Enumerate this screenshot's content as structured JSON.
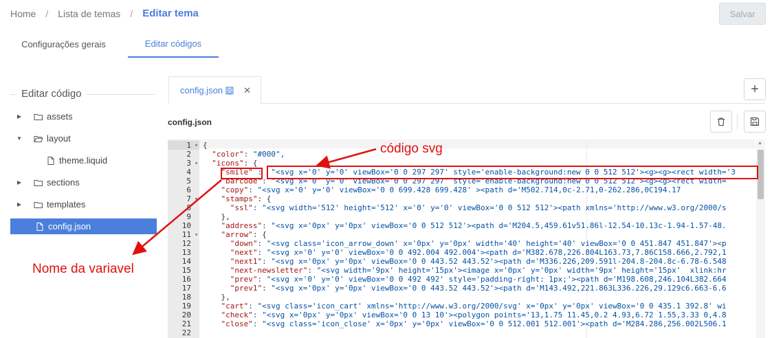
{
  "breadcrumb": {
    "home": "Home",
    "list": "Lista de temas",
    "current": "Editar tema",
    "separator": "/"
  },
  "header": {
    "save_label": "Salvar"
  },
  "tabs": [
    {
      "label": "Configurações gerais",
      "active": false
    },
    {
      "label": "Editar códigos",
      "active": true
    }
  ],
  "sidebar": {
    "title": "Editar código",
    "items": [
      {
        "label": "assets",
        "caret": "▶",
        "icon": "folder-icon"
      },
      {
        "label": "layout",
        "caret": "▼",
        "icon": "folder-open-icon"
      },
      {
        "label": "theme.liquid",
        "caret": "",
        "icon": "file-icon"
      },
      {
        "label": "sections",
        "caret": "▶",
        "icon": "folder-icon"
      },
      {
        "label": "templates",
        "caret": "▶",
        "icon": "folder-icon"
      },
      {
        "label": "config.json",
        "caret": "",
        "icon": "file-icon",
        "selected": true
      }
    ]
  },
  "editor": {
    "open_tab": "config.json",
    "tab_close": "✕",
    "add_label": "+",
    "file_title": "config.json",
    "gutter": [
      {
        "n": "1",
        "fold": "▾"
      },
      {
        "n": "2",
        "fold": ""
      },
      {
        "n": "3",
        "fold": "▾"
      },
      {
        "n": "4",
        "fold": ""
      },
      {
        "n": "5",
        "fold": ""
      },
      {
        "n": "6",
        "fold": ""
      },
      {
        "n": "7",
        "fold": "▾"
      },
      {
        "n": "8",
        "fold": ""
      },
      {
        "n": "9",
        "fold": ""
      },
      {
        "n": "10",
        "fold": ""
      },
      {
        "n": "11",
        "fold": "▾"
      },
      {
        "n": "12",
        "fold": ""
      },
      {
        "n": "13",
        "fold": ""
      },
      {
        "n": "14",
        "fold": ""
      },
      {
        "n": "15",
        "fold": ""
      },
      {
        "n": "16",
        "fold": ""
      },
      {
        "n": "17",
        "fold": ""
      },
      {
        "n": "18",
        "fold": ""
      },
      {
        "n": "19",
        "fold": ""
      },
      {
        "n": "20",
        "fold": ""
      },
      {
        "n": "21",
        "fold": ""
      },
      {
        "n": "22",
        "fold": ""
      }
    ],
    "lines": [
      {
        "indent": "",
        "key": "",
        "rest": "{"
      },
      {
        "indent": "  ",
        "key": "\"color\"",
        "rest": ": \"#000\","
      },
      {
        "indent": "  ",
        "key": "\"icons\"",
        "rest": ": {"
      },
      {
        "indent": "    ",
        "key": "\"smile\"",
        "rest": " :  \"<svg x='0' y='0' viewBox='0 0 297 297' style='enable-background:new 0 0 512 512'><g><g><rect width='3"
      },
      {
        "indent": "    ",
        "key": "\"barcode\"",
        "rest": ": \"<svg x='0' y='0' viewBox='0 0 297 297' style='enable-background:new 0 0 512 512'><g><g><rect width="
      },
      {
        "indent": "    ",
        "key": "\"copy\"",
        "rest": ": \"<svg x='0' y='0' viewBox='0 0 699.428 699.428' ><path d='M502.714,0c-2.71,0-262.286,0C194.17"
      },
      {
        "indent": "    ",
        "key": "\"stamps\"",
        "rest": ": {"
      },
      {
        "indent": "      ",
        "key": "\"ssl\"",
        "rest": ": \"<svg width='512' height='512' x='0' y='0' viewBox='0 0 512 512'><path xmlns='http://www.w3.org/2000/s"
      },
      {
        "indent": "    ",
        "key": "",
        "rest": "},"
      },
      {
        "indent": "    ",
        "key": "\"address\"",
        "rest": ": \"<svg x='0px' y='0px' viewBox='0 0 512 512'><path d='M204.5,459.61v51.86l-12.54-10.13c-1.94-1.57-48."
      },
      {
        "indent": "    ",
        "key": "\"arrow\"",
        "rest": ": {"
      },
      {
        "indent": "      ",
        "key": "\"down\"",
        "rest": ": \"<svg class='icon_arrow_down' x='0px' y='0px' width='40' height='40' viewBox='0 0 451.847 451.847'><p"
      },
      {
        "indent": "      ",
        "key": "\"next\"",
        "rest": ": \"<svg x='0' y='0' viewBox='0 0 492.004 492.004'><path d='M382.678,226.804L163.73,7.86C158.666,2.792,1"
      },
      {
        "indent": "      ",
        "key": "\"next1\"",
        "rest": ": \"<svg x='0px' y='0px' viewBox='0 0 443.52 443.52'><path d='M336.226,209.591l-204.8-204.8c-6.78-6.548"
      },
      {
        "indent": "      ",
        "key": "\"next-newsletter\"",
        "rest": ": \"<svg width='9px' height='15px'><image x='0px' y='0px' width='9px' height='15px'  xlink:hr"
      },
      {
        "indent": "      ",
        "key": "\"prev\"",
        "rest": ": \"<svg x='0' y='0' viewBox='0 0 492 492' style='padding-right: 1px;'><path d='M198.608,246.104L382.664"
      },
      {
        "indent": "      ",
        "key": "\"prev1\"",
        "rest": ": \"<svg x='0px' y='0px' viewBox='0 0 443.52 443.52'><path d='M143.492,221.863L336.226,29.129c6.663-6.6"
      },
      {
        "indent": "    ",
        "key": "",
        "rest": "},"
      },
      {
        "indent": "    ",
        "key": "\"cart\"",
        "rest": ": \"<svg class='icon_cart' xmlns='http://www.w3.org/2000/svg' x='0px' y='0px' viewBox='0 0 435.1 392.8' wi"
      },
      {
        "indent": "    ",
        "key": "\"check\"",
        "rest": ": \"<svg x='0px' y='0px' viewBox='0 0 13 10'><polygon points='13,1.75 11.45,0.2 4.93,6.72 1.55,3.33 0,4.8"
      },
      {
        "indent": "    ",
        "key": "\"close\"",
        "rest": ": \"<svg class='icon_close' x='0px' y='0px' viewBox='0 0 512.001 512.001'><path d='M284.286,256.002L506.1"
      },
      {
        "indent": "    ",
        "key": "",
        "rest": ""
      }
    ]
  },
  "annotations": {
    "svg_label": "código svg",
    "var_label": "Nome da variavel"
  },
  "colors": {
    "accent": "#4a7fdc",
    "annotation": "#e01010",
    "json_key": "#a31515",
    "json_string": "#0451a5"
  }
}
